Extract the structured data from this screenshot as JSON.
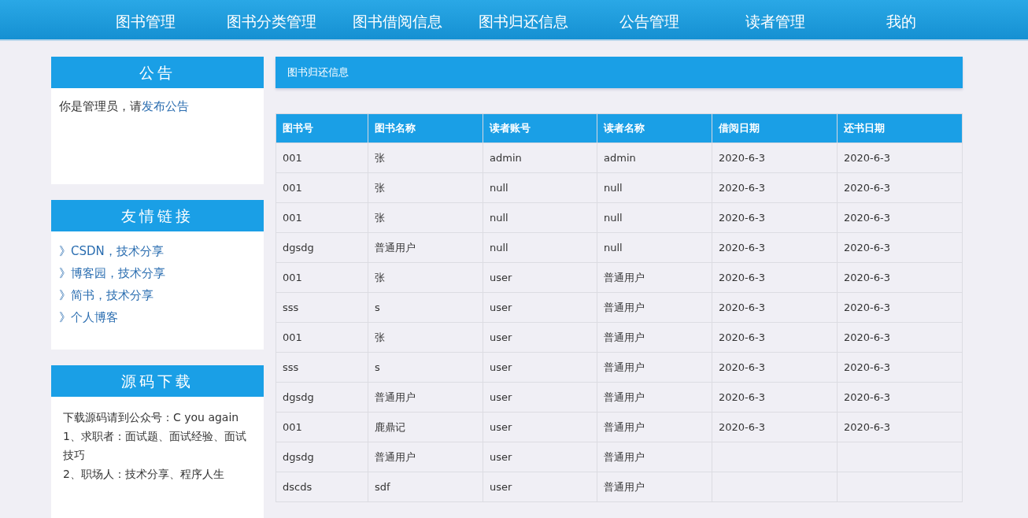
{
  "nav": [
    {
      "label": "图书管理"
    },
    {
      "label": "图书分类管理"
    },
    {
      "label": "图书借阅信息"
    },
    {
      "label": "图书归还信息"
    },
    {
      "label": "公告管理"
    },
    {
      "label": "读者管理"
    },
    {
      "label": "我的"
    }
  ],
  "notice": {
    "title": "公告",
    "text": "你是管理员，请",
    "link": "发布公告"
  },
  "links": {
    "title": "友情链接",
    "items": [
      "》CSDN，技术分享",
      "》博客园，技术分享",
      "》简书，技术分享",
      "》个人博客"
    ]
  },
  "download": {
    "title": "源码下载",
    "lines": [
      "下载源码请到公众号：C you again",
      "1、求职者：面试题、面试经验、面试技巧",
      "2、职场人：技术分享、程序人生"
    ]
  },
  "panel": {
    "title": "图书归还信息"
  },
  "table": {
    "columns": [
      "图书号",
      "图书名称",
      "读者账号",
      "读者名称",
      "借阅日期",
      "还书日期"
    ],
    "rows": [
      [
        "001",
        "张",
        "admin",
        "admin",
        "2020-6-3",
        "2020-6-3"
      ],
      [
        "001",
        "张",
        "null",
        "null",
        "2020-6-3",
        "2020-6-3"
      ],
      [
        "001",
        "张",
        "null",
        "null",
        "2020-6-3",
        "2020-6-3"
      ],
      [
        "dgsdg",
        "普通用户",
        "null",
        "null",
        "2020-6-3",
        "2020-6-3"
      ],
      [
        "001",
        "张",
        "user",
        "普通用户",
        "2020-6-3",
        "2020-6-3"
      ],
      [
        "sss",
        "s",
        "user",
        "普通用户",
        "2020-6-3",
        "2020-6-3"
      ],
      [
        "001",
        "张",
        "user",
        "普通用户",
        "2020-6-3",
        "2020-6-3"
      ],
      [
        "sss",
        "s",
        "user",
        "普通用户",
        "2020-6-3",
        "2020-6-3"
      ],
      [
        "dgsdg",
        "普通用户",
        "user",
        "普通用户",
        "2020-6-3",
        "2020-6-3"
      ],
      [
        "001",
        "鹿鼎记",
        "user",
        "普通用户",
        "2020-6-3",
        "2020-6-3"
      ],
      [
        "dgsdg",
        "普通用户",
        "user",
        "普通用户"
      ],
      [
        "dscds",
        "sdf",
        "user",
        "普通用户"
      ]
    ]
  }
}
